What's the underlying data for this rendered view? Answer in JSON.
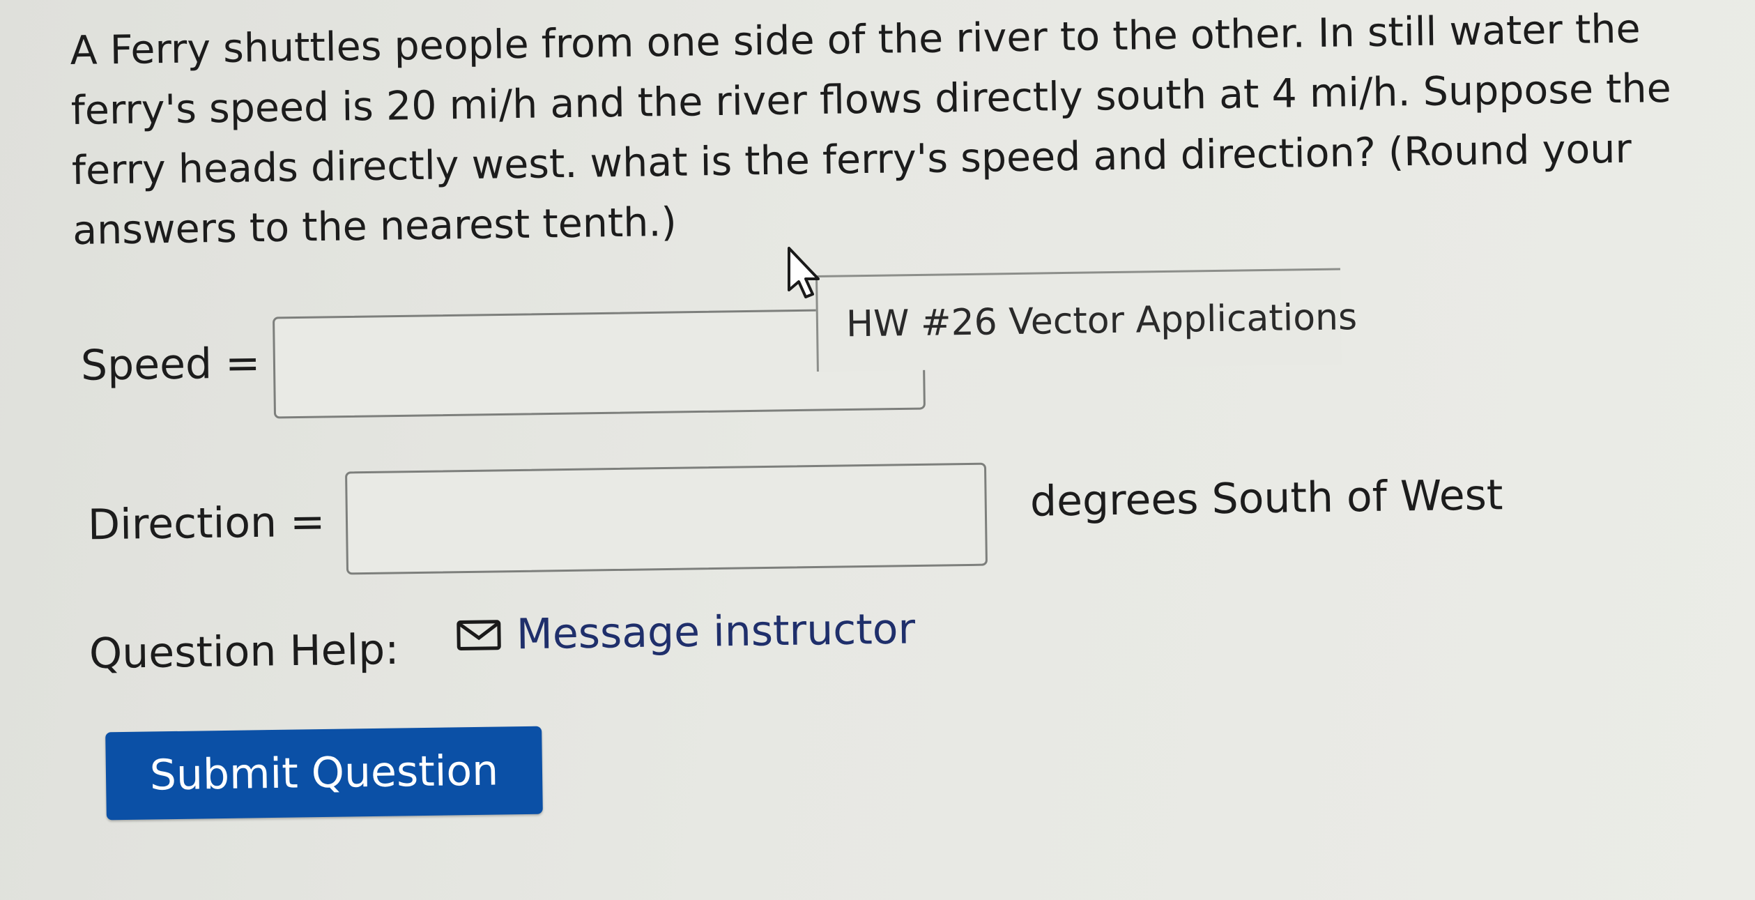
{
  "question": {
    "text": "A Ferry shuttles people from one side of the river to the other. In still water the ferry's speed is 20 mi/h and the river flows directly south at 4 mi/h. Suppose the ferry heads directly west. what is the ferry's speed and direction? (Round your answers to the nearest tenth.)"
  },
  "fields": {
    "speed_label": "Speed =",
    "speed_value": "",
    "direction_label": "Direction =",
    "direction_value": "",
    "direction_unit": "degrees South of West"
  },
  "tooltip": {
    "text": "HW #26 Vector Applications"
  },
  "help": {
    "label": "Question Help:",
    "link_text": "Message instructor",
    "link_icon": "mail-icon"
  },
  "actions": {
    "submit_label": "Submit Question"
  },
  "colors": {
    "submit_background": "#0b50a6",
    "link_color": "#1f2f6b"
  }
}
